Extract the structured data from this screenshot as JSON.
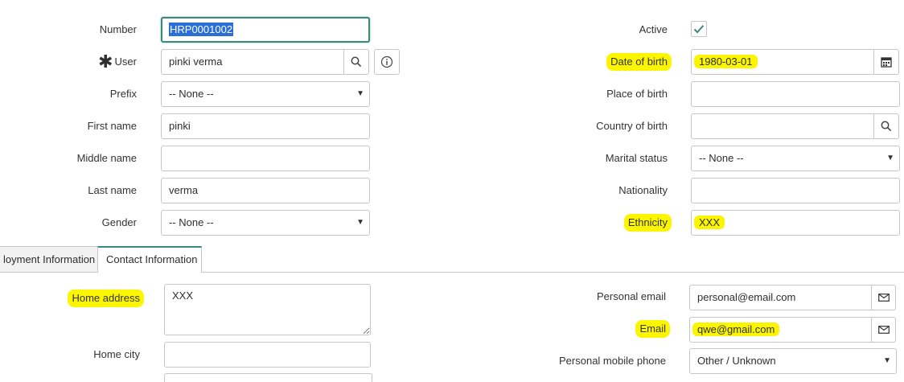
{
  "colors": {
    "accent": "#3a8a7c",
    "highlight": "#fbf500",
    "border": "#c6c6c6"
  },
  "left": {
    "number_label": "Number",
    "number_value": "HRP0001002",
    "user_label": "User",
    "user_value": "pinki verma",
    "prefix_label": "Prefix",
    "prefix_value": "-- None --",
    "first_name_label": "First name",
    "first_name_value": "pinki",
    "middle_name_label": "Middle name",
    "middle_name_value": "",
    "last_name_label": "Last name",
    "last_name_value": "verma",
    "gender_label": "Gender",
    "gender_value": "-- None --"
  },
  "right": {
    "active_label": "Active",
    "active_checked": true,
    "dob_label": "Date of birth",
    "dob_value": "1980-03-01",
    "place_of_birth_label": "Place of birth",
    "place_of_birth_value": "",
    "country_of_birth_label": "Country of birth",
    "country_of_birth_value": "",
    "marital_status_label": "Marital status",
    "marital_status_value": "-- None --",
    "nationality_label": "Nationality",
    "nationality_value": "",
    "ethnicity_label": "Ethnicity",
    "ethnicity_value": "XXX"
  },
  "tabs": [
    {
      "label": "loyment Information",
      "active": false
    },
    {
      "label": "Contact Information",
      "active": true
    }
  ],
  "contact": {
    "home_address_label": "Home address",
    "home_address_value": "XXX",
    "home_city_label": "Home city",
    "home_city_value": "",
    "personal_email_label": "Personal email",
    "personal_email_value": "personal@email.com",
    "email_label": "Email",
    "email_value": "qwe@gmail.com",
    "personal_mobile_label": "Personal mobile phone",
    "personal_mobile_value": "Other / Unknown"
  },
  "icons": {
    "required": "asterisk-icon",
    "lookup": "search-icon",
    "info": "info-icon",
    "calendar": "calendar-icon",
    "email": "envelope-icon",
    "checkbox": "checkmark-icon",
    "dropdown": "caret-down-icon"
  }
}
